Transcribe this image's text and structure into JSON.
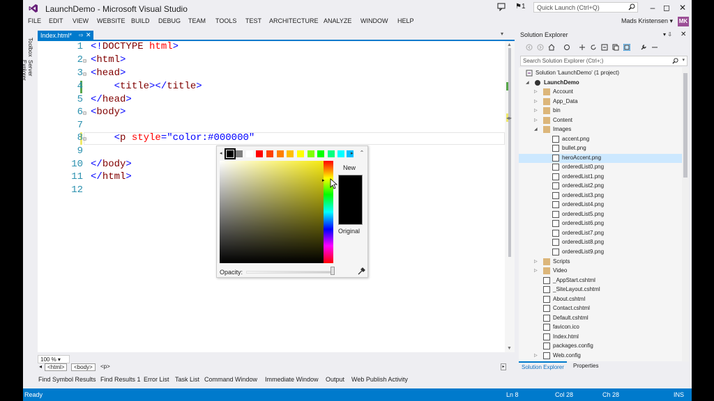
{
  "window": {
    "title": "LaunchDemo - Microsoft Visual Studio",
    "flag_count": "1",
    "quick_launch_placeholder": "Quick Launch (Ctrl+Q)",
    "user_name": "Mads Kristensen",
    "user_initials": "MK",
    "minimize": "–",
    "restore": "◻",
    "close": "✕"
  },
  "menu": [
    "FILE",
    "EDIT",
    "VIEW",
    "WEBSITE",
    "BUILD",
    "DEBUG",
    "TEAM",
    "TOOLS",
    "TEST",
    "ARCHITECTURE",
    "ANALYZE",
    "WINDOW",
    "HELP"
  ],
  "left_dock": [
    "Toolbox",
    "Server Explorer"
  ],
  "doc_tab": {
    "label": "Index.html*",
    "pin": "⇨",
    "close": "✕"
  },
  "editor": {
    "line_numbers": [
      "1",
      "2",
      "3",
      "4",
      "5",
      "6",
      "7",
      "8",
      "9",
      "10",
      "11",
      "12"
    ],
    "lines": [
      {
        "b1": "<!",
        "tag": "DOCTYPE",
        "attr": " html",
        "b2": ">"
      },
      {
        "b1": "<",
        "tag": "html",
        "b2": ">"
      },
      {
        "b1": "<",
        "tag": "head",
        "b2": ">"
      },
      {
        "indent": "    ",
        "b1": "<",
        "tag": "title",
        "b2": "></",
        "tag2": "title",
        "b3": ">"
      },
      {
        "b1": "</",
        "tag": "head",
        "b2": ">"
      },
      {
        "b1": "<",
        "tag": "body",
        "b2": ">"
      },
      {
        "text": ""
      },
      {
        "indent": "    ",
        "b1": "<",
        "tag": "p",
        "attr": " style",
        "eq": "=",
        "str": "\"color:#000000\""
      },
      {
        "text": ""
      },
      {
        "b1": "</",
        "tag": "body",
        "b2": ">"
      },
      {
        "b1": "</",
        "tag": "html",
        "b2": ">"
      },
      {
        "text": ""
      }
    ],
    "zoom": "100 %"
  },
  "color_picker": {
    "swatches": [
      "#000000",
      "#808080",
      "#ffffff",
      "#ff0000",
      "#ff4000",
      "#ff8000",
      "#ffbf00",
      "#ffff00",
      "#80ff00",
      "#00ff00",
      "#00ff80",
      "#00ffff",
      "#00bfff",
      "#0080ff"
    ],
    "selected_swatch": 0,
    "new_label": "New",
    "original_label": "Original",
    "opacity_label": "Opacity:",
    "current_color": "#000000",
    "opacity": 1.0
  },
  "breadcrumbs": [
    "<html>",
    "<body>",
    "<p>"
  ],
  "bottom_tabs": [
    "Find Symbol Results",
    "Find Results 1",
    "Error List",
    "Task List",
    "Command Window",
    "Immediate Window",
    "Output",
    "Web Publish Activity"
  ],
  "status": {
    "ready": "Ready",
    "ln": "Ln 8",
    "col": "Col 28",
    "ch": "Ch 28",
    "ins": "INS"
  },
  "solution_explorer": {
    "title": "Solution Explorer",
    "search_placeholder": "Search Solution Explorer (Ctrl+;)",
    "items": [
      {
        "label": "Solution 'LaunchDemo' (1 project)",
        "kind": "solution"
      },
      {
        "label": "LaunchDemo",
        "kind": "project"
      },
      {
        "label": "Account",
        "kind": "folder"
      },
      {
        "label": "App_Data",
        "kind": "folder"
      },
      {
        "label": "bin",
        "kind": "folder"
      },
      {
        "label": "Content",
        "kind": "folder"
      },
      {
        "label": "Images",
        "kind": "folder-open"
      },
      {
        "label": "accent.png",
        "kind": "image"
      },
      {
        "label": "bullet.png",
        "kind": "image"
      },
      {
        "label": "heroAccent.png",
        "kind": "image",
        "selected": true
      },
      {
        "label": "orderedList0.png",
        "kind": "image"
      },
      {
        "label": "orderedList1.png",
        "kind": "image"
      },
      {
        "label": "orderedList2.png",
        "kind": "image"
      },
      {
        "label": "orderedList3.png",
        "kind": "image"
      },
      {
        "label": "orderedList4.png",
        "kind": "image"
      },
      {
        "label": "orderedList5.png",
        "kind": "image"
      },
      {
        "label": "orderedList6.png",
        "kind": "image"
      },
      {
        "label": "orderedList7.png",
        "kind": "image"
      },
      {
        "label": "orderedList8.png",
        "kind": "image"
      },
      {
        "label": "orderedList9.png",
        "kind": "image"
      },
      {
        "label": "Scripts",
        "kind": "folder"
      },
      {
        "label": "Video",
        "kind": "folder"
      },
      {
        "label": "_AppStart.cshtml",
        "kind": "file"
      },
      {
        "label": "_SiteLayout.cshtml",
        "kind": "file"
      },
      {
        "label": "About.cshtml",
        "kind": "file"
      },
      {
        "label": "Contact.cshtml",
        "kind": "file"
      },
      {
        "label": "Default.cshtml",
        "kind": "file"
      },
      {
        "label": "favicon.ico",
        "kind": "file"
      },
      {
        "label": "Index.html",
        "kind": "file"
      },
      {
        "label": "packages.config",
        "kind": "file"
      },
      {
        "label": "Web.config",
        "kind": "file"
      }
    ],
    "tab_active": "Solution Explorer",
    "tab_other": "Properties"
  },
  "colors": {
    "accent": "#007acc",
    "chrome": "#eeeef2",
    "line_number": "#2b91af",
    "html_tag": "#800000",
    "html_attr": "#ff0000",
    "html_value": "#0000ff"
  }
}
